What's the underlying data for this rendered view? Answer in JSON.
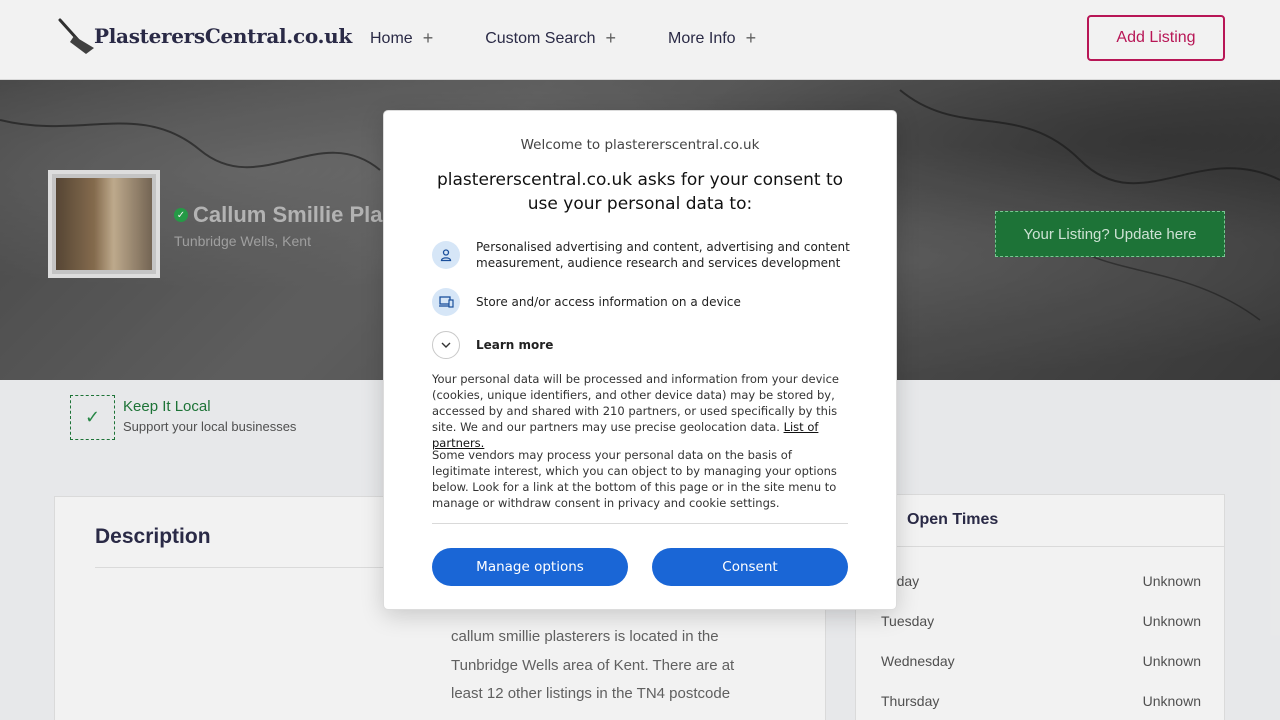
{
  "header": {
    "logo_text": "PlasterersCentral.co.uk",
    "nav": [
      {
        "label": "Home"
      },
      {
        "label": "Custom Search"
      },
      {
        "label": "More Info"
      }
    ],
    "add_listing": "Add Listing"
  },
  "hero": {
    "business_name": "Callum Smillie Pla",
    "location": "Tunbridge Wells, Kent",
    "update_button": "Your Listing? Update here"
  },
  "keep_local": {
    "title": "Keep It Local",
    "subtitle": "Support your local businesses"
  },
  "description": {
    "title": "Description",
    "lines": [
      "callum smillie plasterers is located in the",
      "Tunbridge Wells area of Kent. There are at",
      "least 12 other listings in the TN4 postcode"
    ]
  },
  "open_times": {
    "title": "Open Times",
    "rows": [
      {
        "day": "onday",
        "value": "Unknown"
      },
      {
        "day": "Tuesday",
        "value": "Unknown"
      },
      {
        "day": "Wednesday",
        "value": "Unknown"
      },
      {
        "day": "Thursday",
        "value": "Unknown"
      }
    ]
  },
  "consent": {
    "welcome": "Welcome to plastererscentral.co.uk",
    "heading": "plastererscentral.co.uk asks for your consent to use your personal data to:",
    "purposes": [
      {
        "icon": "person-icon",
        "text": "Personalised advertising and content, advertising and content measurement, audience research and services development"
      },
      {
        "icon": "devices-icon",
        "text": "Store and/or access information on a device"
      }
    ],
    "learn_more": "Learn more",
    "paragraph1": "Your personal data will be processed and information from your device (cookies, unique identifiers, and other device data) may be stored by, accessed by and shared with 210 partners, or used specifically by this site. We and our partners may use precise geolocation data.",
    "partners_link": "List of partners.",
    "paragraph2": "Some vendors may process your personal data on the basis of legitimate interest, which you can object to by managing your options below. Look for a link at the bottom of this page or in the site menu to manage or withdraw consent in privacy and cookie settings.",
    "manage_button": "Manage options",
    "consent_button": "Consent"
  },
  "colors": {
    "brand_pink": "#c2185b",
    "green": "#1f7a3a",
    "consent_blue": "#1a66d6"
  }
}
